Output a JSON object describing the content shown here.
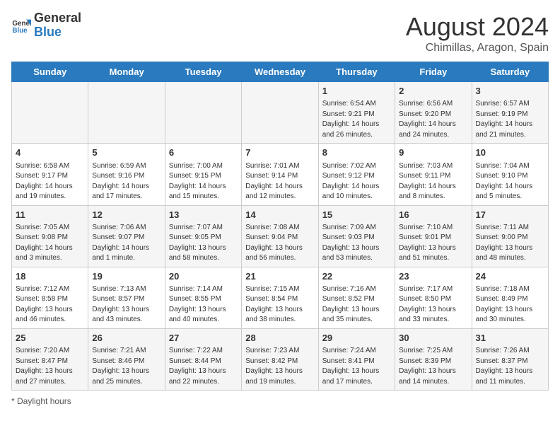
{
  "logo": {
    "text_general": "General",
    "text_blue": "Blue"
  },
  "header": {
    "title": "August 2024",
    "subtitle": "Chimillas, Aragon, Spain"
  },
  "weekdays": [
    "Sunday",
    "Monday",
    "Tuesday",
    "Wednesday",
    "Thursday",
    "Friday",
    "Saturday"
  ],
  "weeks": [
    [
      {
        "day": "",
        "info": ""
      },
      {
        "day": "",
        "info": ""
      },
      {
        "day": "",
        "info": ""
      },
      {
        "day": "",
        "info": ""
      },
      {
        "day": "1",
        "info": "Sunrise: 6:54 AM\nSunset: 9:21 PM\nDaylight: 14 hours and 26 minutes."
      },
      {
        "day": "2",
        "info": "Sunrise: 6:56 AM\nSunset: 9:20 PM\nDaylight: 14 hours and 24 minutes."
      },
      {
        "day": "3",
        "info": "Sunrise: 6:57 AM\nSunset: 9:19 PM\nDaylight: 14 hours and 21 minutes."
      }
    ],
    [
      {
        "day": "4",
        "info": "Sunrise: 6:58 AM\nSunset: 9:17 PM\nDaylight: 14 hours and 19 minutes."
      },
      {
        "day": "5",
        "info": "Sunrise: 6:59 AM\nSunset: 9:16 PM\nDaylight: 14 hours and 17 minutes."
      },
      {
        "day": "6",
        "info": "Sunrise: 7:00 AM\nSunset: 9:15 PM\nDaylight: 14 hours and 15 minutes."
      },
      {
        "day": "7",
        "info": "Sunrise: 7:01 AM\nSunset: 9:14 PM\nDaylight: 14 hours and 12 minutes."
      },
      {
        "day": "8",
        "info": "Sunrise: 7:02 AM\nSunset: 9:12 PM\nDaylight: 14 hours and 10 minutes."
      },
      {
        "day": "9",
        "info": "Sunrise: 7:03 AM\nSunset: 9:11 PM\nDaylight: 14 hours and 8 minutes."
      },
      {
        "day": "10",
        "info": "Sunrise: 7:04 AM\nSunset: 9:10 PM\nDaylight: 14 hours and 5 minutes."
      }
    ],
    [
      {
        "day": "11",
        "info": "Sunrise: 7:05 AM\nSunset: 9:08 PM\nDaylight: 14 hours and 3 minutes."
      },
      {
        "day": "12",
        "info": "Sunrise: 7:06 AM\nSunset: 9:07 PM\nDaylight: 14 hours and 1 minute."
      },
      {
        "day": "13",
        "info": "Sunrise: 7:07 AM\nSunset: 9:05 PM\nDaylight: 13 hours and 58 minutes."
      },
      {
        "day": "14",
        "info": "Sunrise: 7:08 AM\nSunset: 9:04 PM\nDaylight: 13 hours and 56 minutes."
      },
      {
        "day": "15",
        "info": "Sunrise: 7:09 AM\nSunset: 9:03 PM\nDaylight: 13 hours and 53 minutes."
      },
      {
        "day": "16",
        "info": "Sunrise: 7:10 AM\nSunset: 9:01 PM\nDaylight: 13 hours and 51 minutes."
      },
      {
        "day": "17",
        "info": "Sunrise: 7:11 AM\nSunset: 9:00 PM\nDaylight: 13 hours and 48 minutes."
      }
    ],
    [
      {
        "day": "18",
        "info": "Sunrise: 7:12 AM\nSunset: 8:58 PM\nDaylight: 13 hours and 46 minutes."
      },
      {
        "day": "19",
        "info": "Sunrise: 7:13 AM\nSunset: 8:57 PM\nDaylight: 13 hours and 43 minutes."
      },
      {
        "day": "20",
        "info": "Sunrise: 7:14 AM\nSunset: 8:55 PM\nDaylight: 13 hours and 40 minutes."
      },
      {
        "day": "21",
        "info": "Sunrise: 7:15 AM\nSunset: 8:54 PM\nDaylight: 13 hours and 38 minutes."
      },
      {
        "day": "22",
        "info": "Sunrise: 7:16 AM\nSunset: 8:52 PM\nDaylight: 13 hours and 35 minutes."
      },
      {
        "day": "23",
        "info": "Sunrise: 7:17 AM\nSunset: 8:50 PM\nDaylight: 13 hours and 33 minutes."
      },
      {
        "day": "24",
        "info": "Sunrise: 7:18 AM\nSunset: 8:49 PM\nDaylight: 13 hours and 30 minutes."
      }
    ],
    [
      {
        "day": "25",
        "info": "Sunrise: 7:20 AM\nSunset: 8:47 PM\nDaylight: 13 hours and 27 minutes."
      },
      {
        "day": "26",
        "info": "Sunrise: 7:21 AM\nSunset: 8:46 PM\nDaylight: 13 hours and 25 minutes."
      },
      {
        "day": "27",
        "info": "Sunrise: 7:22 AM\nSunset: 8:44 PM\nDaylight: 13 hours and 22 minutes."
      },
      {
        "day": "28",
        "info": "Sunrise: 7:23 AM\nSunset: 8:42 PM\nDaylight: 13 hours and 19 minutes."
      },
      {
        "day": "29",
        "info": "Sunrise: 7:24 AM\nSunset: 8:41 PM\nDaylight: 13 hours and 17 minutes."
      },
      {
        "day": "30",
        "info": "Sunrise: 7:25 AM\nSunset: 8:39 PM\nDaylight: 13 hours and 14 minutes."
      },
      {
        "day": "31",
        "info": "Sunrise: 7:26 AM\nSunset: 8:37 PM\nDaylight: 13 hours and 11 minutes."
      }
    ]
  ],
  "footer": {
    "note": "Daylight hours"
  }
}
